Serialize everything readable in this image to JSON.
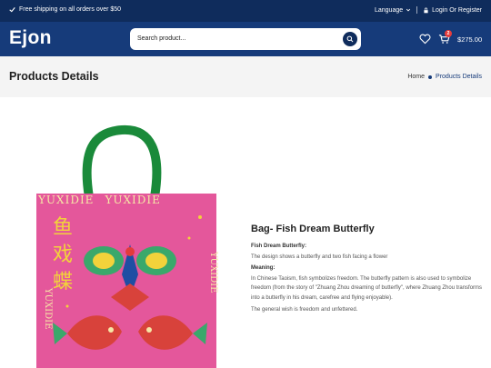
{
  "topbar": {
    "shipping": "Free shipping on all orders over $50",
    "language": "Language",
    "login": "Login Or Register"
  },
  "header": {
    "logo": "Ejon",
    "search_placeholder": "Search product...",
    "cart_count": "2",
    "cart_total": "$275.00"
  },
  "page": {
    "title": "Products Details",
    "breadcrumb": [
      "Home",
      "Products Details"
    ]
  },
  "product": {
    "image_text": {
      "brand": "YUXIDIE",
      "chars": [
        "鱼",
        "戏",
        "蝶"
      ]
    },
    "name": "Bag- Fish Dream Butterfly",
    "section1_title": "Fish Dream Butterfly:",
    "section1_text": "The design shows a butterfly and two fish facing a flower",
    "section2_title": "Meaning:",
    "section2_text": "In Chinese Taoism, fish symbolizes freedom. The butterfly pattern is also used to symbolize freedom (from the story of \"Zhuang Zhou dreaming of butterfly\", where Zhuang Zhou transforms into a butterfly in his dream, carefree and flying enjoyable).",
    "section2_text2": "The general wish is freedom and unfettered."
  },
  "colors": {
    "topbar": "#0f2c5c",
    "header": "#163b7a",
    "bag_pink": "#e4579b",
    "handle_green": "#1a8a3a"
  },
  "icons": [
    "check-icon",
    "chevron-down-icon",
    "lock-icon",
    "search-icon",
    "heart-icon",
    "cart-icon"
  ]
}
